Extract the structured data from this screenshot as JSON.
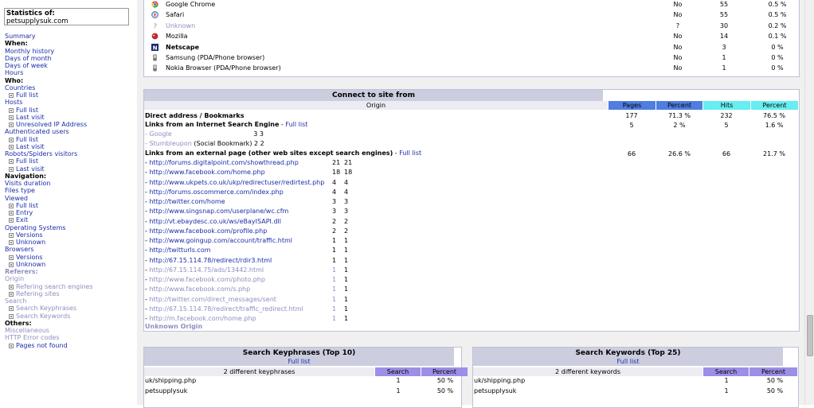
{
  "sidebar": {
    "stat_label": "Statistics of:",
    "site": "petsupplysuk.com",
    "items": [
      {
        "label": "Summary",
        "kind": "link"
      },
      {
        "label": "When:",
        "kind": "head"
      },
      {
        "label": "Monthly history",
        "kind": "link"
      },
      {
        "label": "Days of month",
        "kind": "link"
      },
      {
        "label": "Days of week",
        "kind": "link"
      },
      {
        "label": "Hours",
        "kind": "link"
      },
      {
        "label": "Who:",
        "kind": "head"
      },
      {
        "label": "Countries",
        "kind": "link"
      },
      {
        "label": "Full list",
        "kind": "sub"
      },
      {
        "label": "Hosts",
        "kind": "link"
      },
      {
        "label": "Full list",
        "kind": "sub"
      },
      {
        "label": "Last visit",
        "kind": "sub"
      },
      {
        "label": "Unresolved IP Address",
        "kind": "sub"
      },
      {
        "label": "Authenticated users",
        "kind": "link"
      },
      {
        "label": "Full list",
        "kind": "sub"
      },
      {
        "label": "Last visit",
        "kind": "sub"
      },
      {
        "label": "Robots/Spiders visitors",
        "kind": "link"
      },
      {
        "label": "Full list",
        "kind": "sub"
      },
      {
        "label": "Last visit",
        "kind": "sub"
      },
      {
        "label": "Navigation:",
        "kind": "head"
      },
      {
        "label": "Visits duration",
        "kind": "link"
      },
      {
        "label": "Files type",
        "kind": "link"
      },
      {
        "label": "Viewed",
        "kind": "link"
      },
      {
        "label": "Full list",
        "kind": "sub"
      },
      {
        "label": "Entry",
        "kind": "sub"
      },
      {
        "label": "Exit",
        "kind": "sub"
      },
      {
        "label": "Operating Systems",
        "kind": "link"
      },
      {
        "label": "Versions",
        "kind": "sub"
      },
      {
        "label": "Unknown",
        "kind": "sub"
      },
      {
        "label": "Browsers",
        "kind": "link"
      },
      {
        "label": "Versions",
        "kind": "sub"
      },
      {
        "label": "Unknown",
        "kind": "sub"
      },
      {
        "label": "Referers:",
        "kind": "headfaded"
      },
      {
        "label": "Origin",
        "kind": "faded"
      },
      {
        "label": "Refering search engines",
        "kind": "subfaded"
      },
      {
        "label": "Refering sites",
        "kind": "subfaded"
      },
      {
        "label": "Search",
        "kind": "faded"
      },
      {
        "label": "Search Keyphrases",
        "kind": "subfaded"
      },
      {
        "label": "Search Keywords",
        "kind": "subfaded"
      },
      {
        "label": "Others:",
        "kind": "head"
      },
      {
        "label": "Miscellaneous",
        "kind": "faded"
      },
      {
        "label": "HTTP Error codes",
        "kind": "faded"
      },
      {
        "label": "Pages not found",
        "kind": "sub"
      }
    ]
  },
  "browsers": [
    {
      "name": "Google Chrome",
      "grabber": "No",
      "hits": "55",
      "percent": "0.5 %",
      "icon": "chrome-icon",
      "faded": false,
      "bold": false
    },
    {
      "name": "Safari",
      "grabber": "No",
      "hits": "55",
      "percent": "0.5 %",
      "icon": "safari-icon",
      "faded": false,
      "bold": false
    },
    {
      "name": "Unknown",
      "grabber": "?",
      "hits": "30",
      "percent": "0.2 %",
      "icon": "question-icon",
      "faded": true,
      "bold": false
    },
    {
      "name": "Mozilla",
      "grabber": "No",
      "hits": "14",
      "percent": "0.1 %",
      "icon": "mozilla-icon",
      "faded": false,
      "bold": false
    },
    {
      "name": "Netscape",
      "grabber": "No",
      "hits": "3",
      "percent": "0 %",
      "icon": "netscape-icon",
      "faded": false,
      "bold": true
    },
    {
      "name": "Samsung (PDA/Phone browser)",
      "grabber": "No",
      "hits": "1",
      "percent": "0 %",
      "icon": "phone-icon",
      "faded": false,
      "bold": false
    },
    {
      "name": "Nokia Browser (PDA/Phone browser)",
      "grabber": "No",
      "hits": "1",
      "percent": "0 %",
      "icon": "phone-icon",
      "faded": false,
      "bold": false
    }
  ],
  "connect": {
    "title": "Connect to site from",
    "headers": {
      "origin": "Origin",
      "pages": "Pages",
      "percent1": "Percent",
      "hits": "Hits",
      "percent2": "Percent"
    },
    "direct": {
      "label": "Direct address / Bookmarks",
      "pages": "177",
      "ppct": "71.3 %",
      "hits": "232",
      "hpct": "76.5 %"
    },
    "search": {
      "label": "Links from an Internet Search Engine",
      "link": "Full list",
      "pages": "5",
      "ppct": "2 %",
      "hits": "5",
      "hpct": "1.6 %"
    },
    "engines": [
      {
        "name": "Google",
        "text": "3 3"
      },
      {
        "name": "Stumbleupon",
        "suffix": "(Social Bookmark)",
        "text": "2 2"
      }
    ],
    "external": {
      "label": "Links from an external page (other web sites except search engines)",
      "link": "Full list",
      "pages": "66",
      "ppct": "26.6 %",
      "hits": "66",
      "hpct": "21.7 %"
    },
    "sites": [
      {
        "url": "http://forums.digitalpoint.com/showthread.php",
        "p": "21",
        "h": "21",
        "faded": false
      },
      {
        "url": "http://www.facebook.com/home.php",
        "p": "18",
        "h": "18",
        "faded": false
      },
      {
        "url": "http://www.ukpets.co.uk/ukp/redirectuser/redirtest.php",
        "p": "4",
        "h": "4",
        "faded": false
      },
      {
        "url": "http://forums.oscommerce.com/index.php",
        "p": "4",
        "h": "4",
        "faded": false
      },
      {
        "url": "http://twitter.com/home",
        "p": "3",
        "h": "3",
        "faded": false
      },
      {
        "url": "http://www.singsnap.com/userplane/wc.cfm",
        "p": "3",
        "h": "3",
        "faded": false
      },
      {
        "url": "http://vt.ebaydesc.co.uk/ws/eBayISAPI.dll",
        "p": "2",
        "h": "2",
        "faded": false
      },
      {
        "url": "http://www.facebook.com/profile.php",
        "p": "2",
        "h": "2",
        "faded": false
      },
      {
        "url": "http://www.goingup.com/account/traffic.html",
        "p": "1",
        "h": "1",
        "faded": false
      },
      {
        "url": "http://twitturls.com",
        "p": "1",
        "h": "1",
        "faded": false
      },
      {
        "url": "http://67.15.114.78/redirect/rdir3.html",
        "p": "1",
        "h": "1",
        "faded": false
      },
      {
        "url": "http://67.15.114.75/ads/13442.html",
        "p": "1",
        "h": "1",
        "faded": true
      },
      {
        "url": "http://www.facebook.com/photo.php",
        "p": "1",
        "h": "1",
        "faded": true
      },
      {
        "url": "http://www.facebook.com/s.php",
        "p": "1",
        "h": "1",
        "faded": true
      },
      {
        "url": "http://twitter.com/direct_messages/sent",
        "p": "1",
        "h": "1",
        "faded": true
      },
      {
        "url": "http://67.15.114.78/redirect/traffic_redirect.html",
        "p": "1",
        "h": "1",
        "faded": true
      },
      {
        "url": "http://m.facebook.com/home.php",
        "p": "1",
        "h": "1",
        "faded": true
      }
    ],
    "unknown": "Unknown Origin"
  },
  "keyphrases": {
    "title": "Search Keyphrases (Top 10)",
    "link": "Full list",
    "count": "2 different keyphrases",
    "h_search": "Search",
    "h_percent": "Percent",
    "rows": [
      {
        "k": "uk/shipping.php",
        "s": "1",
        "p": "50 %"
      },
      {
        "k": "petsupplysuk",
        "s": "1",
        "p": "50 %"
      }
    ]
  },
  "keywords": {
    "title": "Search Keywords (Top 25)",
    "link": "Full list",
    "count": "2 different keywords",
    "h_search": "Search",
    "h_percent": "Percent",
    "rows": [
      {
        "k": "uk/shipping.php",
        "s": "1",
        "p": "50 %"
      },
      {
        "k": "petsupplysuk",
        "s": "1",
        "p": "50 %"
      }
    ]
  }
}
